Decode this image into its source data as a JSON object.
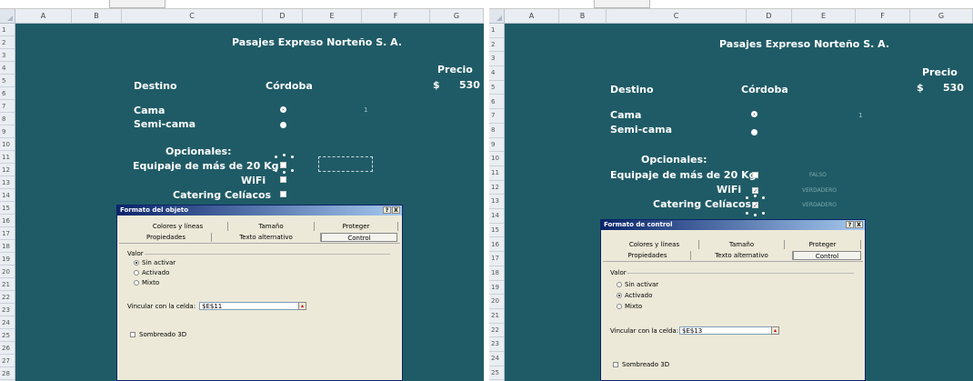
{
  "columns": [
    "A",
    "B",
    "C",
    "D",
    "E",
    "F",
    "G"
  ],
  "rows_left": [
    "1",
    "2",
    "3",
    "4",
    "5",
    "6",
    "7",
    "8",
    "9",
    "10",
    "11",
    "12",
    "13",
    "14",
    "15",
    "16",
    "17",
    "18",
    "19",
    "20",
    "21",
    "22",
    "23",
    "24",
    "25",
    "26",
    "27",
    "28"
  ],
  "rows_right": [
    "1",
    "2",
    "3",
    "4",
    "5",
    "6",
    "7",
    "8",
    "9",
    "10",
    "11",
    "12",
    "13",
    "14",
    "15",
    "16",
    "17",
    "18",
    "19",
    "20",
    "21",
    "22",
    "23",
    "24",
    "25"
  ],
  "colors": {
    "sheet_bg": "#1f5b66",
    "header_bg": "#eaeef3",
    "dialog_bg": "#ece9d8",
    "title_bar": "#0a246a"
  },
  "sheet": {
    "company": "Pasajes Expreso Norteño S. A.",
    "precio_label": "Precio",
    "currency": "$",
    "price": "530",
    "destino_label": "Destino",
    "destino_value": "Córdoba",
    "cama": "Cama",
    "semicama": "Semi-cama",
    "radio_cell_value": "1",
    "opcionales": "Opcionales:",
    "equipaje": "Equipaje de más de 20 Kg",
    "wifi": "WiFi",
    "catering": "Catering Celíacos"
  },
  "right_values": {
    "e11": "FALSO",
    "e12": "VERDADERO",
    "e13": "VERDADERO"
  },
  "dialog_left": {
    "title": "Formato del objeto",
    "help": "?",
    "close": "X",
    "tabs_row1": [
      "Colores y líneas",
      "Tamaño",
      "Proteger"
    ],
    "tabs_row2": [
      "Propiedades",
      "Texto alternativo",
      "Control"
    ],
    "valor": "Valor",
    "options": [
      "Sin activar",
      "Activado",
      "Mixto"
    ],
    "selected": "Sin activar",
    "link_label": "Vincular con la celda:",
    "link_value": "$E$11",
    "shading": "Sombreado 3D"
  },
  "dialog_right": {
    "title": "Formato de control",
    "help": "?",
    "close": "X",
    "tabs_row1": [
      "Colores y líneas",
      "Tamaño",
      "Proteger"
    ],
    "tabs_row2": [
      "Propiedades",
      "Texto alternativo",
      "Control"
    ],
    "valor": "Valor",
    "options": [
      "Sin activar",
      "Activado",
      "Mixto"
    ],
    "selected": "Activado",
    "link_label": "Vincular con la celda:",
    "link_value": "$E$13",
    "shading": "Sombreado 3D"
  }
}
